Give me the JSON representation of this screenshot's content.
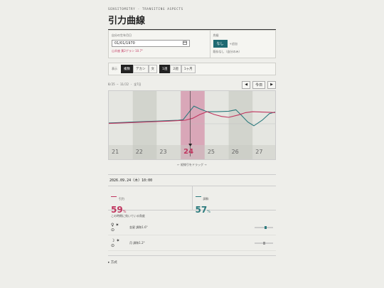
{
  "header": {
    "eyebrow": "SENSITOMETRY · TRANSITING ASPECTS",
    "title": "引力曲線"
  },
  "birth": {
    "label": "自分の生年月日",
    "value": "01/01/1970",
    "calendar_icon": "calendar-icon",
    "note": "山羊座 黄2ゲラン 10.7°"
  },
  "sign": {
    "label": "兆候",
    "none_button": "なし",
    "add_link": "+追加",
    "note": "既存なし（自分のみ）"
  },
  "display": {
    "label": "表示",
    "options": [
      {
        "label": "複数",
        "on": true
      },
      {
        "label": "デカン",
        "on": false
      },
      {
        "label": "文",
        "on": false
      },
      {
        "label": "1週",
        "on": true
      },
      {
        "label": "2週",
        "on": false
      },
      {
        "label": "1ヶ月",
        "on": false
      }
    ]
  },
  "nav": {
    "range": "8/25 — 11/22 · 全7日",
    "prev": "◀",
    "today": "今日",
    "next": "▶"
  },
  "chart_data": {
    "type": "line",
    "x": [
      21,
      22,
      23,
      24,
      25,
      26,
      27
    ],
    "x_tick_labels": [
      "21",
      "22",
      "23",
      "24",
      "25",
      "26",
      "27"
    ],
    "selected_day": "24",
    "ylim": [
      0,
      100
    ],
    "series": [
      {
        "color": "#c0365f",
        "values": [
          37,
          40,
          42,
          44,
          55,
          50,
          60
        ]
      },
      {
        "color": "#2b7a7d",
        "values": [
          38,
          41,
          43,
          45,
          72,
          63,
          41
        ]
      }
    ],
    "pink_line": [
      [
        0,
        37
      ],
      [
        0.5,
        38
      ],
      [
        1,
        39
      ],
      [
        1.5,
        40
      ],
      [
        2,
        41
      ],
      [
        2.5,
        42
      ],
      [
        2.9,
        43
      ],
      [
        3.2,
        44
      ],
      [
        3.5,
        48
      ],
      [
        3.8,
        56
      ],
      [
        4.1,
        62
      ],
      [
        4.4,
        56
      ],
      [
        4.7,
        52
      ],
      [
        5,
        50
      ],
      [
        5.4,
        55
      ],
      [
        5.7,
        60
      ],
      [
        6,
        62
      ],
      [
        6.5,
        61
      ],
      [
        7,
        60
      ]
    ],
    "teal_line": [
      [
        0,
        38
      ],
      [
        0.5,
        39
      ],
      [
        1,
        40
      ],
      [
        1.5,
        41
      ],
      [
        2,
        42
      ],
      [
        2.5,
        43
      ],
      [
        2.9,
        44
      ],
      [
        3.1,
        45
      ],
      [
        3.3,
        58
      ],
      [
        3.55,
        74
      ],
      [
        3.8,
        68
      ],
      [
        4.1,
        62
      ],
      [
        4.5,
        62
      ],
      [
        5,
        63
      ],
      [
        5.3,
        66
      ],
      [
        5.5,
        56
      ],
      [
        5.8,
        40
      ],
      [
        6.05,
        32
      ],
      [
        6.4,
        44
      ],
      [
        6.7,
        58
      ],
      [
        7,
        62
      ]
    ]
  },
  "drag_hint": "← 縦線引をドラッグ →",
  "detail": {
    "date": "2026.09.24（木）10:00",
    "pull": {
      "label": "引力",
      "value": "59",
      "unit": "%",
      "color": "#c0365f"
    },
    "harmony": {
      "label": "調和",
      "value": "57",
      "unit": "%",
      "color": "#2b7a7d"
    },
    "aspects_heading": "この時期に効いている角度",
    "aspects": [
      {
        "glyph1": "♀",
        "glyph2": "✶",
        "glyph3": "⊙",
        "name": "金星 調和1.6°",
        "marker": 0.55,
        "color": "#2b7a7d"
      },
      {
        "glyph1": "☽",
        "glyph2": "✶",
        "glyph3": "⊙",
        "name": "月 調和1.2°",
        "marker": 0.45,
        "color": "#999999"
      }
    ]
  },
  "method": "▸ 方式"
}
